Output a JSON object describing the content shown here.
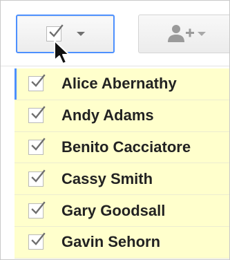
{
  "toolbar": {
    "select_button": {
      "icon": "checkbox-checked-icon",
      "caret": "chevron-down-icon"
    },
    "add_user_button": {
      "icon": "add-person-icon",
      "caret": "chevron-down-icon"
    }
  },
  "contacts": [
    {
      "name": "Alice Abernathy",
      "checked": true
    },
    {
      "name": "Andy Adams",
      "checked": true
    },
    {
      "name": "Benito Cacciatore",
      "checked": true
    },
    {
      "name": "Cassy Smith",
      "checked": true
    },
    {
      "name": "Gary Goodsall",
      "checked": true
    },
    {
      "name": "Gavin Sehorn",
      "checked": true
    }
  ],
  "colors": {
    "row_highlight": "#ffffcc",
    "focus_blue": "#4d90fe",
    "check_gray": "#6f6f6f"
  }
}
